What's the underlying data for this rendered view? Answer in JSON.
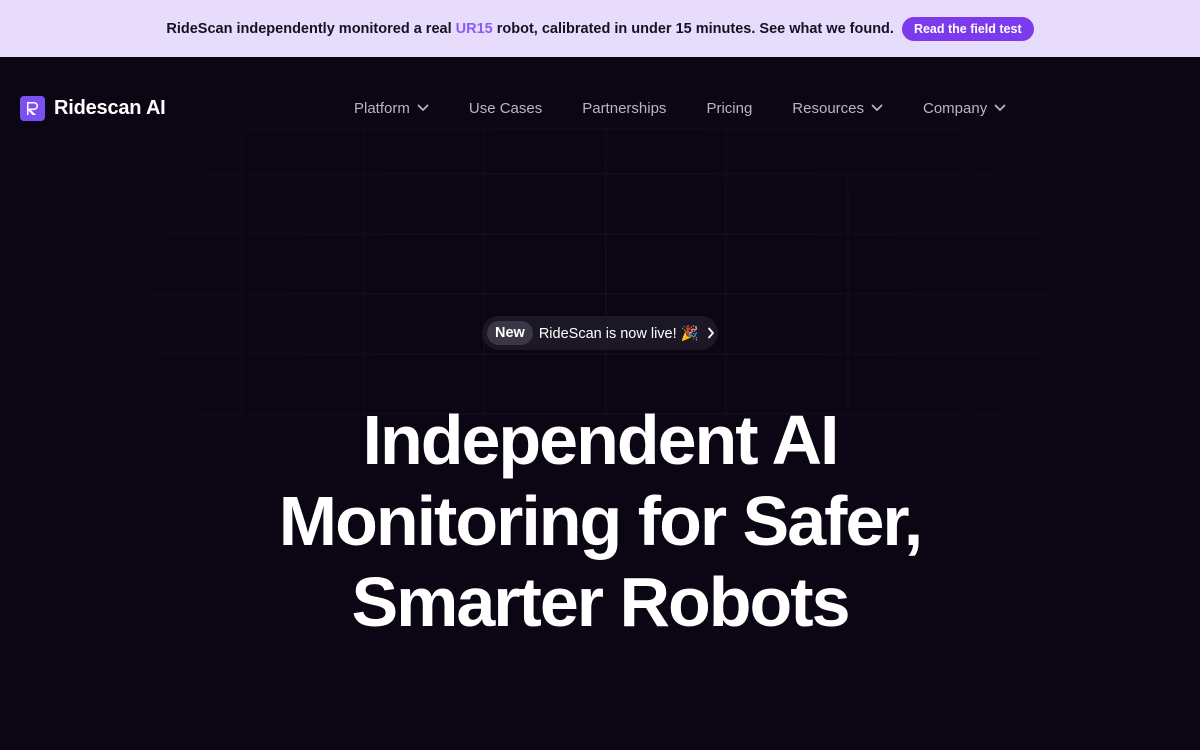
{
  "announcement": {
    "text_before": "RideScan independently monitored a real ",
    "highlight": "UR15",
    "text_after": " robot, calibrated in under 15 minutes. See what we found.",
    "button_label": "Read the field test"
  },
  "brand": {
    "name": "Ridescan AI",
    "icon": "ridescan-logo-icon"
  },
  "nav": {
    "items": [
      {
        "label": "Platform",
        "dropdown": true
      },
      {
        "label": "Use Cases",
        "dropdown": false
      },
      {
        "label": "Partnerships",
        "dropdown": false
      },
      {
        "label": "Pricing",
        "dropdown": false
      },
      {
        "label": "Resources",
        "dropdown": true
      },
      {
        "label": "Company",
        "dropdown": true
      }
    ]
  },
  "badge": {
    "tag": "New",
    "text": "RideScan is now live! 🎉"
  },
  "hero": {
    "line1": "Independent AI",
    "line2": "Monitoring for Safer,",
    "line3": "Smarter Robots"
  },
  "colors": {
    "background": "#0b0514",
    "announcement_bg": "#e7dcfb",
    "accent": "#7c3aed",
    "highlight": "#8b5cf6"
  }
}
